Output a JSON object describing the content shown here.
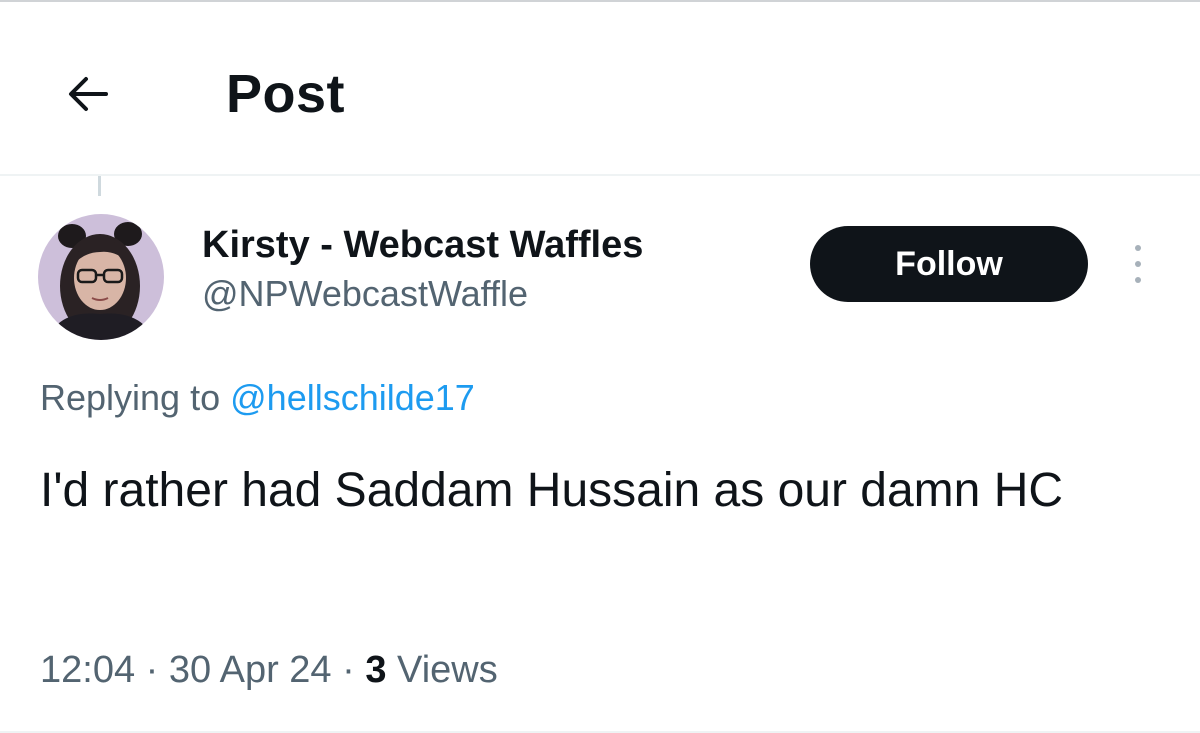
{
  "header": {
    "title": "Post",
    "back_icon": "arrow-left-icon"
  },
  "post": {
    "author": {
      "display_name": "Kirsty - Webcast Waffles",
      "handle": "@NPWebcastWaffle",
      "avatar_icon": "user-avatar"
    },
    "follow_label": "Follow",
    "more_icon": "more-vertical-icon",
    "replying_prefix": "Replying to",
    "replying_to": "@hellschilde17",
    "text": "I'd rather had Saddam Hussain as our damn HC",
    "time": "12:04",
    "separator_1": "·",
    "date": "30 Apr 24",
    "separator_2": "·",
    "views_count": "3",
    "views_label": "Views"
  },
  "colors": {
    "text_primary": "#0f1419",
    "text_secondary": "#536471",
    "link": "#1d9bf0",
    "follow_bg": "#0f1419",
    "follow_text": "#ffffff"
  }
}
